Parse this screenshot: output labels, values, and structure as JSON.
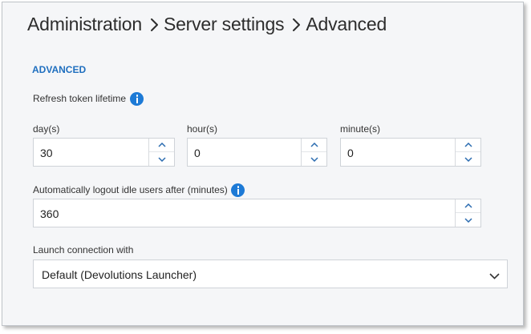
{
  "breadcrumb": {
    "items": [
      "Administration",
      "Server settings",
      "Advanced"
    ]
  },
  "section": {
    "title": "ADVANCED"
  },
  "refresh_token": {
    "label": "Refresh token lifetime",
    "info_icon": "info-icon",
    "days": {
      "label": "day(s)",
      "value": "30"
    },
    "hours": {
      "label": "hour(s)",
      "value": "0"
    },
    "minutes": {
      "label": "minute(s)",
      "value": "0"
    }
  },
  "idle_logout": {
    "label": "Automatically logout idle users after (minutes)",
    "info_icon": "info-icon",
    "value": "360"
  },
  "launch": {
    "label": "Launch connection with",
    "selected": "Default (Devolutions Launcher)"
  },
  "colors": {
    "accent": "#1f6fbf",
    "info_icon": "#1d7ad6",
    "spinner_arrow": "#2b6cb0",
    "panel_bg": "#f5f6f8"
  }
}
